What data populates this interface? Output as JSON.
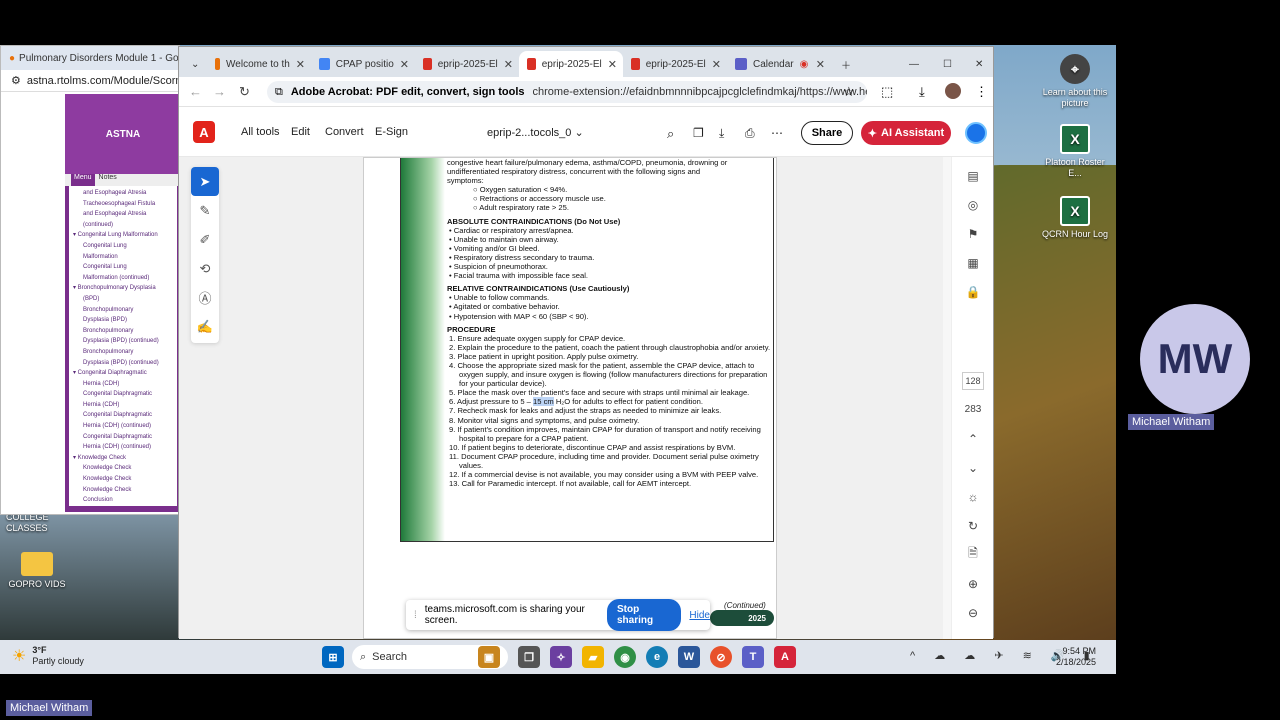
{
  "desktop": {
    "icons": [
      {
        "label": "Learn about this picture",
        "glyph": "⌖"
      },
      {
        "label": "Platoon Roster E...",
        "glyph": "X"
      },
      {
        "label": "QCRN Hour Log",
        "glyph": "X"
      }
    ],
    "folder_college": "COLLEGE CLASSES",
    "folder_gopro": "GOPRO VIDS"
  },
  "left_window": {
    "tab_title": "Pulmonary Disorders Module 1 - Google",
    "address": "astna.rtolms.com/Module/Scorm",
    "banner": "ASTNA",
    "tabs": [
      "Menu",
      "Notes"
    ],
    "menu_items": [
      "and Esophageal Atresia",
      "Tracheoesophageal Fistula",
      "and Esophageal Atresia",
      "(continued)",
      "▾ Congenital Lung Malformation",
      "Congenital Lung",
      "Malformation",
      "Congenital Lung",
      "Malformation (continued)",
      "▾ Bronchopulmonary Dysplasia",
      "(BPD)",
      "Bronchopulmonary",
      "Dysplasia (BPD)",
      "Bronchopulmonary",
      "Dysplasia (BPD) (continued)",
      "Bronchopulmonary",
      "Dysplasia (BPD) (continued)",
      "▾ Congenital Diaphragmatic",
      "Hernia (CDH)",
      "Congenital Diaphragmatic",
      "Hernia (CDH)",
      "Congenital Diaphragmatic",
      "Hernia (CDH) (continued)",
      "Congenital Diaphragmatic",
      "Hernia (CDH) (continued)",
      "▾ Knowledge Check",
      "Knowledge Check",
      "Knowledge Check",
      "Knowledge Check",
      "Conclusion"
    ]
  },
  "browser": {
    "tabs": [
      {
        "label": "Welcome to th",
        "color": "#e8710a"
      },
      {
        "label": "CPAP positio",
        "color": "#4285f4"
      },
      {
        "label": "eprip-2025-El",
        "color": "#d93025"
      },
      {
        "label": "eprip-2025-El",
        "color": "#d93025",
        "active": true
      },
      {
        "label": "eprip-2025-El",
        "color": "#d93025"
      },
      {
        "label": "Calendar",
        "color": "#5b5fc7"
      }
    ],
    "omnibox_site": "Adobe Acrobat: PDF edit, convert, sign tools",
    "omnibox_url": "chrome-extension://efaidnbmnnnibpcajpcglclefindmkaj/https://www.healthver..."
  },
  "acrobat": {
    "menu": [
      "All tools",
      "Edit",
      "Convert",
      "E-Sign"
    ],
    "doc_title": "eprip-2...tocols_0",
    "share": "Share",
    "ai": "AI Assistant",
    "page_current": "128",
    "page_total": "283"
  },
  "pdf": {
    "intro_lines": [
      "congestive heart failure/pulmonary edema, asthma/COPD, pneumonia, drowning or",
      "undifferentiated respiratory distress, concurrent with the following signs and",
      "symptoms:"
    ],
    "intro_bullets": [
      "Oxygen saturation < 94%.",
      "Retractions or accessory muscle use.",
      "Adult respiratory rate > 25."
    ],
    "absolute_heading": "ABSOLUTE CONTRAINDICATIONS (Do Not Use)",
    "absolute": [
      "Cardiac or respiratory arrest/apnea.",
      "Unable to maintain own airway.",
      "Vomiting and/or GI bleed.",
      "Respiratory distress secondary to trauma.",
      "Suspicion of pneumothorax.",
      "Facial trauma with impossible face seal."
    ],
    "relative_heading": "RELATIVE CONTRAINDICATIONS (Use Cautiously)",
    "relative": [
      "Unable to follow commands.",
      "Agitated or combative behavior.",
      "Hypotension with MAP < 60 (SBP < 90)."
    ],
    "procedure_heading": "PROCEDURE",
    "procedure": [
      "1.  Ensure adequate oxygen supply for CPAP device.",
      "2.  Explain the procedure to the patient, coach the patient through claustrophobia and/or anxiety.",
      "3.  Place patient in upright position.  Apply pulse oximetry.",
      "4.  Choose the appropriate sized mask for the patient, assemble the CPAP device, attach to oxygen supply, and insure oxygen is flowing (follow manufacturers directions for preparation for your particular device).",
      "5.  Place the mask over the patient's face and secure with straps until minimal air leakage.",
      "6.  Adjust pressure to 5 – 15 cm H₂O for adults to effect for patient condition.",
      "7.  Recheck mask for leaks and adjust the straps as needed to minimize air leaks.",
      "8.  Monitor vital signs and symptoms, and pulse oximetry.",
      "9.  If patient's condition improves, maintain CPAP for duration of transport and notify receiving hospital to prepare for a CPAP patient.",
      "10. If patient begins to deteriorate, discontinue CPAP and assist respirations by BVM.",
      "11. Document CPAP procedure, including time and provider. Document serial pulse oximetry values.",
      "12. If a commercial devise is not available, you may consider using a BVM with PEEP valve.",
      "13. Call for Paramedic intercept.  If not available, call for AEMT intercept."
    ],
    "continued": "(Continued)",
    "footer_year": "2025"
  },
  "sharing": {
    "message": "teams.microsoft.com is sharing your screen.",
    "stop": "Stop sharing",
    "hide": "Hide"
  },
  "participant": {
    "initials": "MW",
    "name": "Michael Witham"
  },
  "taskbar": {
    "temp": "3°F",
    "weather": "Partly cloudy",
    "search": "Search",
    "time": "9:54 PM",
    "date": "2/18/2025"
  },
  "bottom_name": "Michael Witham"
}
